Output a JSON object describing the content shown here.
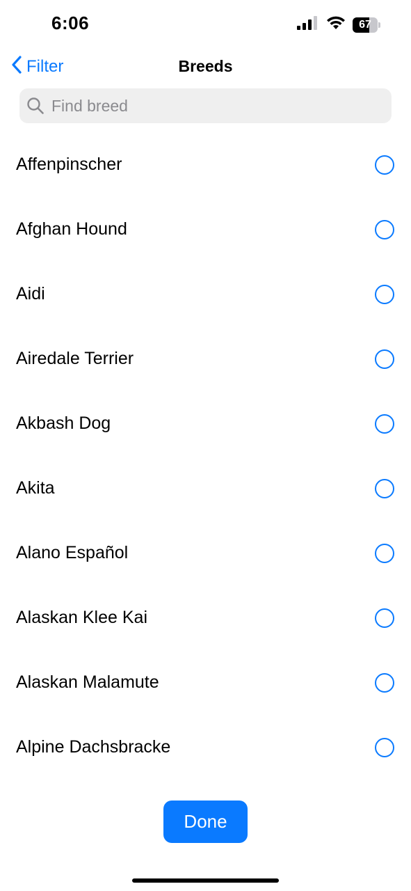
{
  "status_bar": {
    "time": "6:06",
    "battery_level": "67",
    "battery_fraction": 0.67,
    "icons": [
      "cellular-signal-icon",
      "wifi-icon",
      "battery-icon"
    ]
  },
  "nav": {
    "back_label": "Filter",
    "title": "Breeds"
  },
  "search": {
    "placeholder": "Find breed",
    "value": ""
  },
  "breeds": [
    {
      "label": "Affenpinscher",
      "selected": false
    },
    {
      "label": "Afghan Hound",
      "selected": false
    },
    {
      "label": "Aidi",
      "selected": false
    },
    {
      "label": "Airedale Terrier",
      "selected": false
    },
    {
      "label": "Akbash Dog",
      "selected": false
    },
    {
      "label": "Akita",
      "selected": false
    },
    {
      "label": "Alano Español",
      "selected": false
    },
    {
      "label": "Alaskan Klee Kai",
      "selected": false
    },
    {
      "label": "Alaskan Malamute",
      "selected": false
    },
    {
      "label": "Alpine Dachsbracke",
      "selected": false
    }
  ],
  "done_label": "Done",
  "colors": {
    "accent": "#0a7aff",
    "search_bg": "#efefef",
    "placeholder": "#8a8a8e"
  }
}
